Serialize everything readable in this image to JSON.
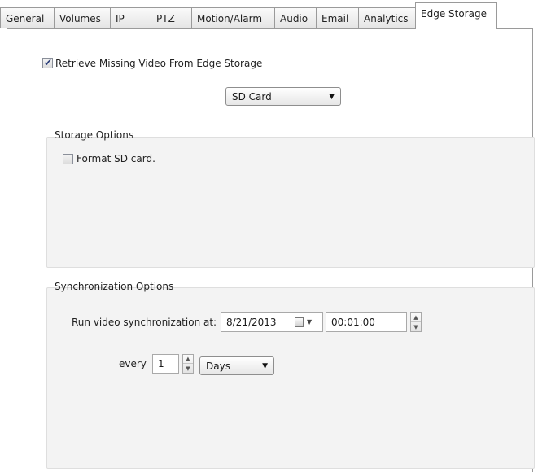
{
  "tabs": [
    {
      "label": "General"
    },
    {
      "label": "Volumes"
    },
    {
      "label": "IP"
    },
    {
      "label": "PTZ"
    },
    {
      "label": "Motion/Alarm"
    },
    {
      "label": "Audio"
    },
    {
      "label": "Email"
    },
    {
      "label": "Analytics"
    },
    {
      "label": "Edge Storage",
      "active": true
    }
  ],
  "retrieve": {
    "label": "Retrieve Missing Video From Edge Storage",
    "checked": true
  },
  "source_select": {
    "value": "SD Card"
  },
  "storage_options": {
    "title": "Storage Options",
    "format_label": "Format SD card.",
    "format_checked": false
  },
  "sync_options": {
    "title": "Synchronization Options",
    "run_label": "Run video synchronization at:",
    "date": "8/21/2013",
    "time": "00:01:00",
    "every_label": "every",
    "every_value": "1",
    "unit": "Days"
  },
  "icons": {
    "check": "checkmark-icon",
    "dropdown": "dropdown-arrow-icon",
    "calendar": "calendar-icon",
    "spin": "spin-buttons"
  }
}
